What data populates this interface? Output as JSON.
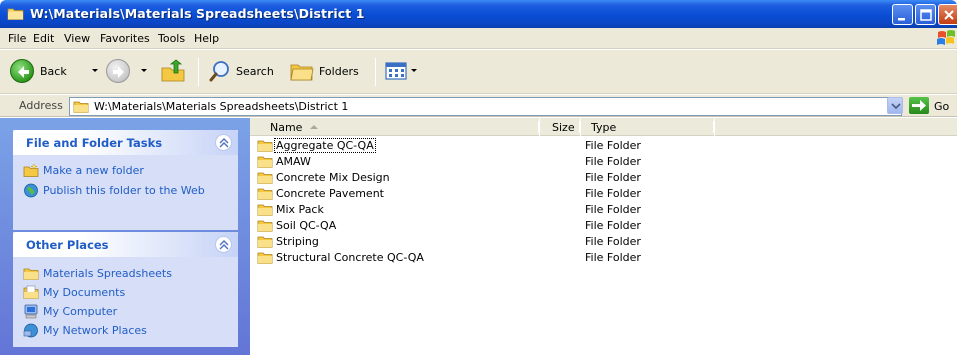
{
  "window": {
    "title": "W:\\Materials\\Materials Spreadsheets\\District 1",
    "title_bar_color": "#0a4fd6"
  },
  "menu": {
    "items": [
      "File",
      "Edit",
      "View",
      "Favorites",
      "Tools",
      "Help"
    ]
  },
  "toolbar": {
    "back_label": "Back",
    "search_label": "Search",
    "folders_label": "Folders"
  },
  "address": {
    "label": "Address",
    "value": "W:\\Materials\\Materials Spreadsheets\\District 1",
    "go_label": "Go"
  },
  "tasks": {
    "file_folder": {
      "title": "File and Folder Tasks",
      "links": [
        "Make a new folder",
        "Publish this folder to the Web"
      ]
    },
    "other_places": {
      "title": "Other Places",
      "links": [
        "Materials Spreadsheets",
        "My Documents",
        "My Computer",
        "My Network Places"
      ]
    }
  },
  "columns": {
    "name": "Name",
    "size": "Size",
    "type": "Type"
  },
  "files": [
    {
      "name": "Aggregate QC-QA",
      "size": "",
      "type": "File Folder"
    },
    {
      "name": "AMAW",
      "size": "",
      "type": "File Folder"
    },
    {
      "name": "Concrete Mix Design",
      "size": "",
      "type": "File Folder"
    },
    {
      "name": "Concrete Pavement",
      "size": "",
      "type": "File Folder"
    },
    {
      "name": "Mix Pack",
      "size": "",
      "type": "File Folder"
    },
    {
      "name": "Soil QC-QA",
      "size": "",
      "type": "File Folder"
    },
    {
      "name": "Striping",
      "size": "",
      "type": "File Folder"
    },
    {
      "name": "Structural Concrete QC-QA",
      "size": "",
      "type": "File Folder"
    }
  ],
  "colors": {
    "link_blue": "#215dc6",
    "pane_gradient_top": "#7ba2e7",
    "pane_gradient_bottom": "#6375d6",
    "chrome": "#ece9d8"
  }
}
